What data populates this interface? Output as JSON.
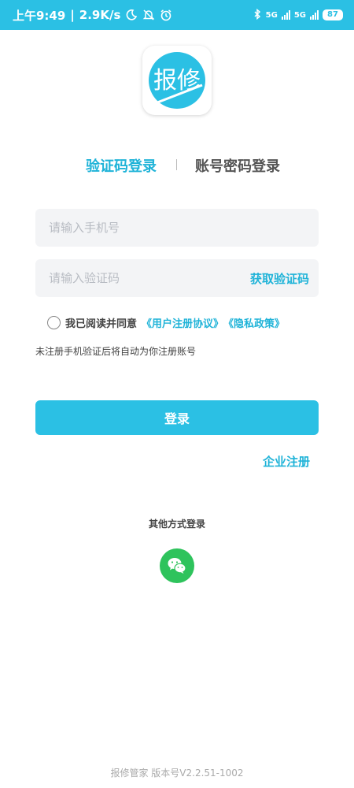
{
  "status_bar": {
    "time": "上午9:49",
    "separator": "|",
    "speed": "2.9K/s",
    "net1": "5G",
    "net2": "5G",
    "battery": "87"
  },
  "logo": {
    "text": "报修"
  },
  "tabs": {
    "sms_login": "验证码登录",
    "password_login": "账号密码登录",
    "active": "sms_login"
  },
  "form": {
    "phone": {
      "placeholder": "请输入手机号",
      "value": ""
    },
    "code": {
      "placeholder": "请输入验证码",
      "value": ""
    },
    "get_code_label": "获取验证码"
  },
  "agreement": {
    "checked": false,
    "prefix": "我已阅读并同意",
    "user_agreement": "《用户注册协议》",
    "privacy_policy": "《隐私政策》"
  },
  "hint": "未注册手机验证后将自动为你注册账号",
  "login_label": "登录",
  "enterprise_register": "企业注册",
  "other_login": {
    "title": "其他方式登录",
    "icon": "wechat-icon"
  },
  "footer": "报修管家 版本号V2.2.51-1002",
  "colors": {
    "accent": "#2bc0e4",
    "link": "#1fb3d8",
    "wechat": "#2ec35c"
  }
}
